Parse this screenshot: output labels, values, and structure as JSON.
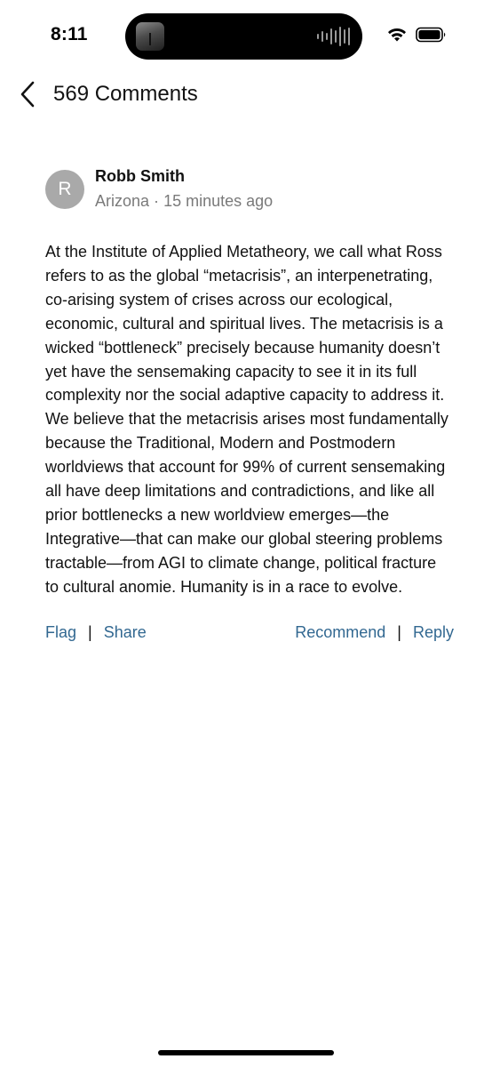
{
  "status_bar": {
    "time": "8:11"
  },
  "header": {
    "title": "569 Comments"
  },
  "comment": {
    "avatar_initial": "R",
    "author": "Robb Smith",
    "location": "Arizona",
    "separator": "·",
    "timestamp": "15 minutes ago",
    "body": "At the Institute of Applied Metatheory, we call what Ross refers to as the global “metacrisis”, an interpenetrating, co-arising system of crises across our ecological, economic, cultural and spiritual lives. The metacrisis is a wicked “bottleneck” precisely because humanity doesn’t yet have the sensemaking capacity to see it in its full complexity nor the social adaptive capacity to address it. We believe that the metacrisis arises most fundamentally because the Traditional, Modern and Postmodern worldviews that account for 99% of current sensemaking all have deep limitations and contradictions, and like all prior bottlenecks a new worldview emerges—the Integrative—that can make our global steering problems tractable—from AGI to climate change, political fracture to cultural anomie. Humanity is in a race to evolve.",
    "actions": {
      "flag": "Flag",
      "share": "Share",
      "recommend": "Recommend",
      "reply": "Reply",
      "divider": "|"
    }
  },
  "colors": {
    "link": "#326891",
    "meta_gray": "#7a7a7a",
    "avatar_bg": "#a9a9a9",
    "text": "#121212"
  },
  "icons": {
    "back": "chevron-left-icon",
    "wifi": "wifi-icon",
    "battery": "battery-icon",
    "now_playing_art": "album-art-icon",
    "now_playing_wave": "waveform-icon"
  }
}
